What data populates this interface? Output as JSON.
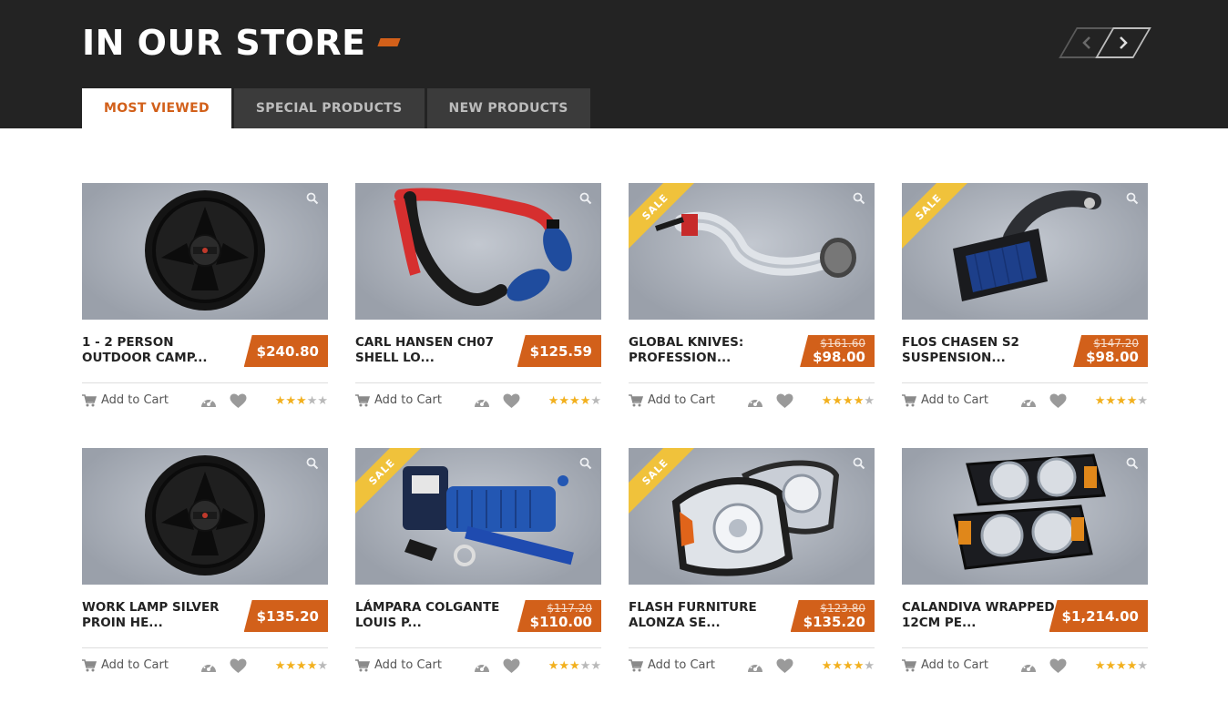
{
  "header": {
    "title": "IN OUR STORE",
    "accent_color": "#d2601a",
    "background": "#232323"
  },
  "nav": {
    "prev_icon": "chevron-left-icon",
    "next_icon": "chevron-right-icon"
  },
  "tabs": [
    {
      "label": "MOST VIEWED",
      "active": true
    },
    {
      "label": "SPECIAL PRODUCTS",
      "active": false
    },
    {
      "label": "NEW PRODUCTS",
      "active": false
    }
  ],
  "labels": {
    "add_to_cart": "Add to Cart",
    "sale": "SALE"
  },
  "products": [
    {
      "name": "1 - 2 PERSON OUTDOOR CAMP...",
      "price": "$240.80",
      "old_price": "",
      "sale": false,
      "rating": 3,
      "image": "wheel"
    },
    {
      "name": "CARL HANSEN CH07 SHELL LO...",
      "price": "$125.59",
      "old_price": "",
      "sale": false,
      "rating": 4,
      "image": "intake-red"
    },
    {
      "name": "GLOBAL KNIVES: PROFESSION...",
      "price": "$98.00",
      "old_price": "$161.60",
      "sale": true,
      "rating": 4,
      "image": "intake-chrome"
    },
    {
      "name": "FLOS CHASEN S2 SUSPENSION...",
      "price": "$98.00",
      "old_price": "$147.20",
      "sale": true,
      "rating": 4,
      "image": "airbox"
    },
    {
      "name": "WORK LAMP SILVER PROIN HE...",
      "price": "$135.20",
      "old_price": "",
      "sale": false,
      "rating": 4,
      "image": "wheel"
    },
    {
      "name": "LÁMPARA COLGANTE LOUIS P...",
      "price": "$110.00",
      "old_price": "$117.20",
      "sale": true,
      "rating": 3,
      "image": "winch"
    },
    {
      "name": "FLASH FURNITURE ALONZA SE...",
      "price": "$135.20",
      "old_price": "$123.80",
      "sale": true,
      "rating": 4,
      "image": "headlights-chrome"
    },
    {
      "name": "CALANDIVA WRAPPED 12CM PE...",
      "price": "$1,214.00",
      "old_price": "",
      "sale": false,
      "rating": 4,
      "image": "headlights-halo"
    }
  ]
}
